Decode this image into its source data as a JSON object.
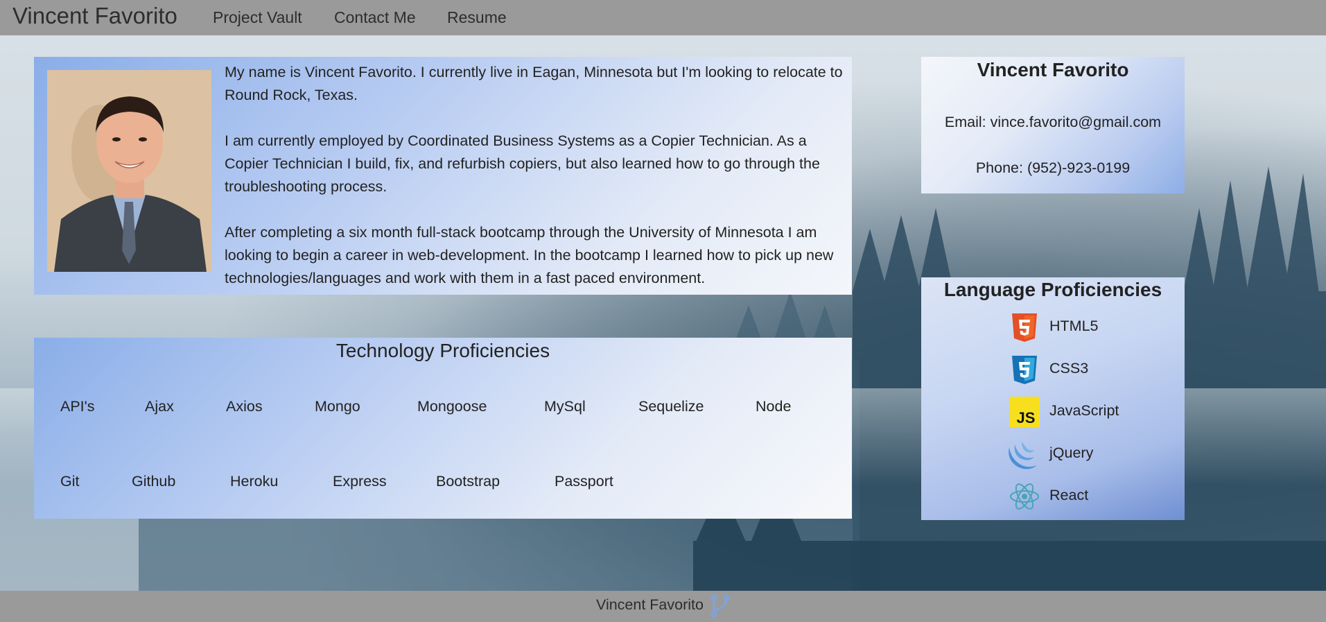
{
  "navbar": {
    "brand": "Vincent Favorito",
    "links": [
      "Project Vault",
      "Contact Me",
      "Resume"
    ]
  },
  "bio": {
    "photo_alt": "Vincent Favorito portrait",
    "paragraphs": [
      "My name is Vincent Favorito. I currently live in Eagan, Minnesota but I'm looking to relocate to Round Rock, Texas.",
      "I am currently employed by Coordinated Business Systems as a Copier Technician. As a Copier Technician I build, fix, and refurbish copiers, but also learned how to go through the troubleshooting process.",
      "After completing a six month full-stack bootcamp through the University of Minnesota I am looking to begin a career in web-development. In the bootcamp I learned how to pick up new technologies/languages and work with them in a fast paced environment."
    ]
  },
  "tech": {
    "title": "Technology Proficiencies",
    "items": [
      "API's",
      "Ajax",
      "Axios",
      "Mongo",
      "Mongoose",
      "MySql",
      "Sequelize",
      "Node",
      "Git",
      "Github",
      "Heroku",
      "Express",
      "Bootstrap",
      "Passport"
    ]
  },
  "contact": {
    "name": "Vincent Favorito",
    "email": "Email: vince.favorito@gmail.com",
    "phone": "Phone: (952)-923-0199"
  },
  "languages": {
    "title": "Language Proficiencies",
    "items": [
      {
        "label": "HTML5",
        "icon": "html5-icon",
        "color": "#e34f26"
      },
      {
        "label": "CSS3",
        "icon": "css3-icon",
        "color": "#1572b6"
      },
      {
        "label": "JavaScript",
        "icon": "javascript-icon",
        "color": "#f7df1e"
      },
      {
        "label": "jQuery",
        "icon": "jquery-icon",
        "color": "#4a8fd8"
      },
      {
        "label": "React",
        "icon": "react-icon",
        "color": "#4aa3b8"
      }
    ]
  },
  "footer": {
    "text": "Vincent Favorito",
    "icon": "fork-icon"
  }
}
